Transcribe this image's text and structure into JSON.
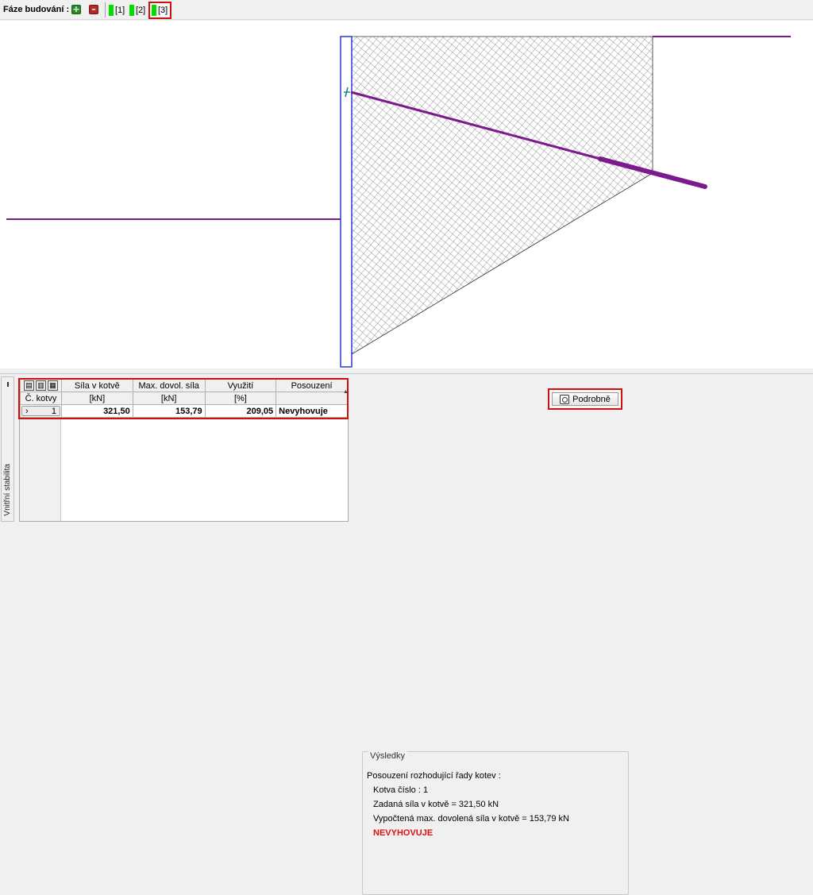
{
  "toolbar": {
    "label": "Fáze budování :",
    "add_icon": "plus-icon",
    "remove_icon": "minus-icon",
    "stages": [
      "[1]",
      "[2]",
      "[3]"
    ],
    "active_stage": "[3]",
    "stage_color": "#00e000"
  },
  "side_tab": {
    "label": "Vnitřní stabilita"
  },
  "table": {
    "header_row1": [
      "Síla v kotvě",
      "Max. dovol. síla",
      "Využití",
      "Posouzení"
    ],
    "header_row2": [
      "Č. kotvy",
      "[kN]",
      "[kN]",
      "[%]",
      ""
    ],
    "rows": [
      {
        "no": "1",
        "force": "321,50",
        "max_force": "153,79",
        "usage": "209,05",
        "verdict": "Nevyhovuje"
      }
    ]
  },
  "results": {
    "legend": "Výsledky",
    "heading": "Posouzení rozhodující řady kotev :",
    "anchor_no": "Kotva číslo : 1",
    "given_force": "Zadaná síla v kotvě = 321,50 kN",
    "computed_force": "Vypočtená max. dovolená síla v kotvě = 153,79 kN",
    "verdict": "NEVYHOVUJE",
    "detail_button": "Podrobně"
  },
  "colors": {
    "terrain": "#7b1a8c",
    "wall": "#1c2fc8",
    "anchor": "#7b1a8c",
    "highlight": "#d01010",
    "fail_text": "#e01010"
  }
}
